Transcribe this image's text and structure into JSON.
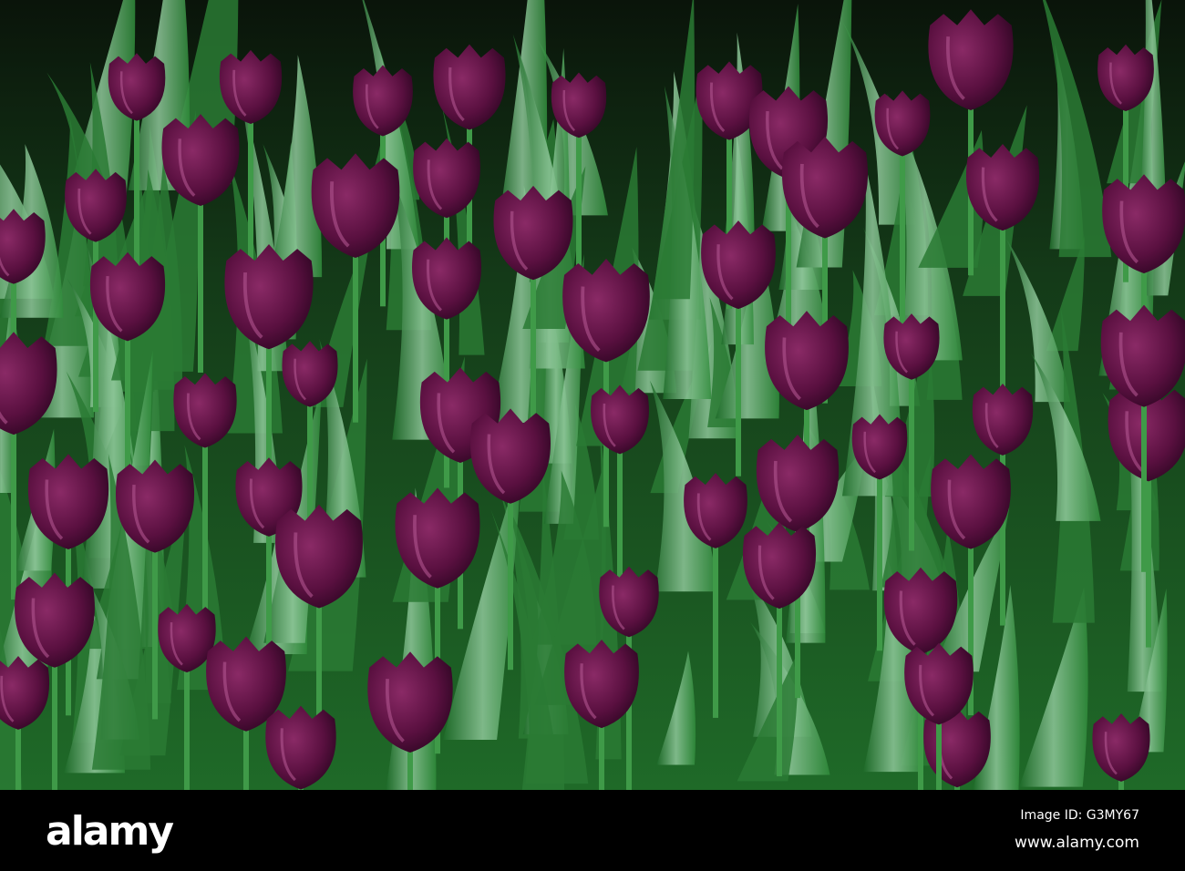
{
  "watermark": {
    "logo": "alamy",
    "image_id": "Image ID: G3MY67",
    "site": "www.alamy.com"
  },
  "colors": {
    "tulip": "#5a1040",
    "tulip_highlight": "#a0407a",
    "leaf": "#2f8a3a",
    "leaf_light": "#8fc79a",
    "background": "#0d1a0d"
  }
}
